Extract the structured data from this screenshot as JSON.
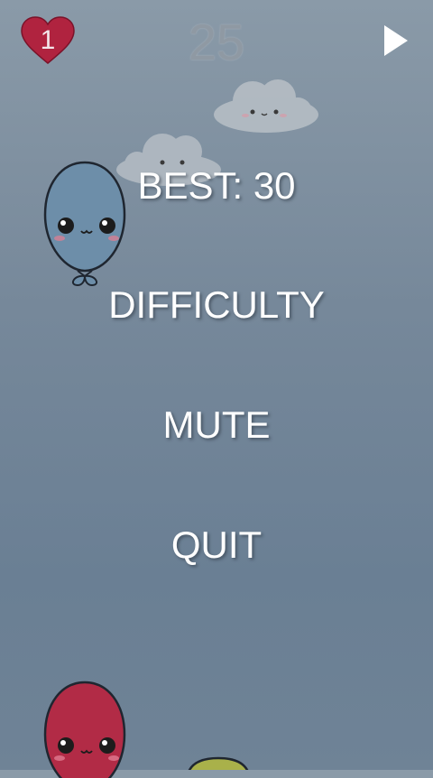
{
  "hud": {
    "lives": "1",
    "score": "25",
    "lives_icon": "heart-icon",
    "play_icon": "play-icon"
  },
  "menu": {
    "best": "BEST: 30",
    "difficulty": "DIFFICULTY",
    "mute": "MUTE",
    "quit": "QUIT"
  },
  "colors": {
    "heart": "#b0233f",
    "balloon_blue": "#6e8faa",
    "balloon_red": "#b02a45",
    "balloon_green": "#a8b24a",
    "cloud": "#b8bfc6",
    "menu_text": "#ffffff",
    "score_text": "#8f99a3"
  }
}
